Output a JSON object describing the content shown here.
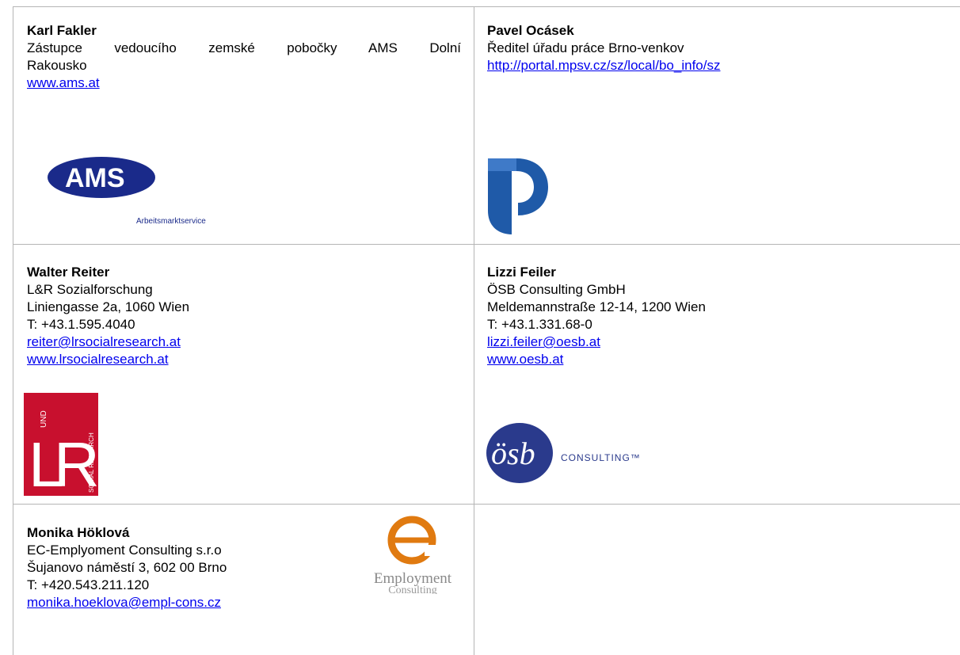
{
  "contacts": [
    {
      "name": "Karl Fakler",
      "role_line1": "Zástupce vedoucího zemské pobočky AMS Dolní",
      "role_line2": "Rakousko",
      "website": "www.ams.at",
      "logo": {
        "text": "AMS",
        "subtext": "Arbeitsmarktservice",
        "colors": {
          "ellipse": "#1a2a8a",
          "s": "#e3001b"
        }
      }
    },
    {
      "name": "Pavel Ocásek",
      "role": "Ředitel úřadu práce Brno-venkov",
      "website": "http://portal.mpsv.cz/sz/local/bo_info/sz",
      "logo": {
        "icon": "up-logo-icon",
        "color": "#1f5aa8"
      }
    },
    {
      "name": "Walter Reiter",
      "organization": "L&R Sozialforschung",
      "address": "Liniengasse 2a, 1060 Wien",
      "phone": "T: +43.1.595.4040",
      "email": "reiter@lrsocialresearch.at",
      "website": "www.lrsocialresearch.at",
      "logo": {
        "letters_l": "L",
        "letters_r": "R",
        "und": "UND",
        "vertical": "SOCIAL RESEARCH",
        "color": "#c8102e"
      }
    },
    {
      "name": "Lizzi Feiler",
      "organization": "ÖSB Consulting GmbH",
      "address": "Meldemannstraße 12-14, 1200 Wien",
      "phone": "T: +43.1.331.68-0",
      "email": "lizzi.feiler@oesb.at",
      "website": "www.oesb.at",
      "logo": {
        "text": "ösb",
        "subtext": "CONSULTING™",
        "color": "#2a3a8c"
      }
    },
    {
      "name": "Monika Höklová",
      "organization": "EC-Emplyoment Consulting s.r.o",
      "address": "Šujanovo náměstí 3, 602 00 Brno",
      "phone": "T: +420.543.211.120",
      "email": "monika.hoeklova@empl-cons.cz",
      "logo": {
        "line1": "Employment",
        "line2": "Consulting",
        "color": "#e07a10"
      }
    }
  ]
}
